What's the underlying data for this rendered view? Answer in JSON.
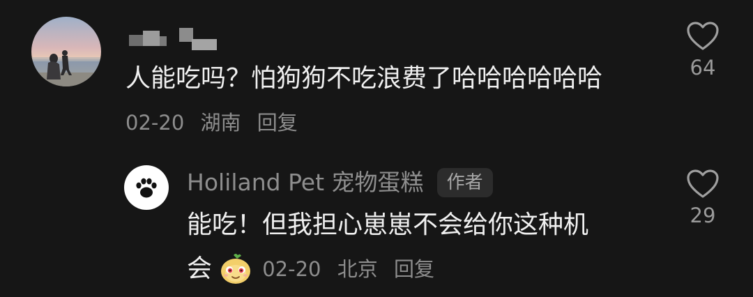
{
  "comment": {
    "username_hidden": true,
    "text": "人能吃吗？怕狗狗不吃浪费了哈哈哈哈哈哈",
    "date": "02-20",
    "location": "湖南",
    "reply_label": "回复",
    "likes": "64",
    "avatar_icon": "beach-photo-avatar"
  },
  "reply": {
    "username": "Holiland Pet 宠物蛋糕",
    "author_badge": "作者",
    "text_line1": "能吃！但我担心崽崽不会给你这种机",
    "text_line2": "会",
    "emoji_icon": "bear-emoji-icon",
    "date": "02-20",
    "location": "北京",
    "reply_label": "回复",
    "likes": "29",
    "avatar_icon": "paw-icon"
  },
  "colors": {
    "background": "#161616",
    "primary_text": "#f0f0f0",
    "secondary_text": "#8e8e8e",
    "badge_bg": "#2c2c2c"
  }
}
